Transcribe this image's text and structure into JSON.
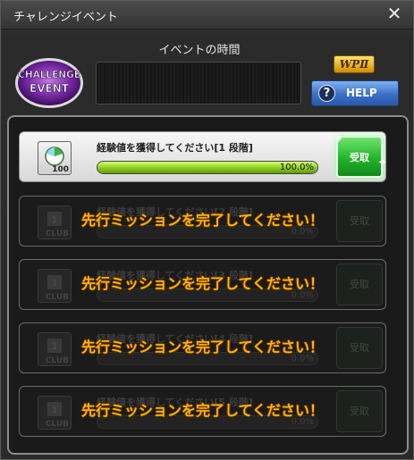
{
  "window": {
    "title": "チャレンジイベント",
    "close_symbol": "✕"
  },
  "header": {
    "badge_line1": "CHALLENGE",
    "badge_line2": "EVENT",
    "event_time_label": "イベントの時間",
    "wp_logo": "WPⅡ",
    "help_label": "HELP",
    "help_icon_symbol": "?"
  },
  "missions": [
    {
      "title": "経験値を獲得してください[1 段階]",
      "progress": 1.0,
      "progress_text": "100.0%",
      "receive_label": "受取",
      "icon_level": "100",
      "icon": "level-icon",
      "state": "active"
    },
    {
      "title": "経験値を獲得してください[2 段階]",
      "progress": 0.0,
      "progress_text": "0.0%",
      "receive_label": "受取",
      "icon": "club-icon",
      "icon_text": "CLUB",
      "state": "locked",
      "lock_message": "先行ミッションを完了してください！"
    },
    {
      "title": "経験値を獲得してください[3 段階]",
      "progress": 0.0,
      "progress_text": "0.0%",
      "receive_label": "受取",
      "icon": "club-icon",
      "icon_text": "CLUB",
      "state": "locked",
      "lock_message": "先行ミッションを完了してください！"
    },
    {
      "title": "経験値を獲得してください[4 段階]",
      "progress": 0.0,
      "progress_text": "0.0%",
      "receive_label": "受取",
      "icon": "club-icon",
      "icon_text": "CLUB",
      "state": "locked",
      "lock_message": "先行ミッションを完了してください！"
    },
    {
      "title": "経験値を獲得してください[5 段階]",
      "progress": 0.0,
      "progress_text": "0.0%",
      "receive_label": "受取",
      "icon": "club-icon",
      "icon_text": "CLUB",
      "state": "locked",
      "lock_message": "先行ミッションを完了してください！"
    }
  ],
  "colors": {
    "accent_green": "#22b42a",
    "help_blue": "#3a6fc8",
    "lock_text": "#ffb400"
  }
}
